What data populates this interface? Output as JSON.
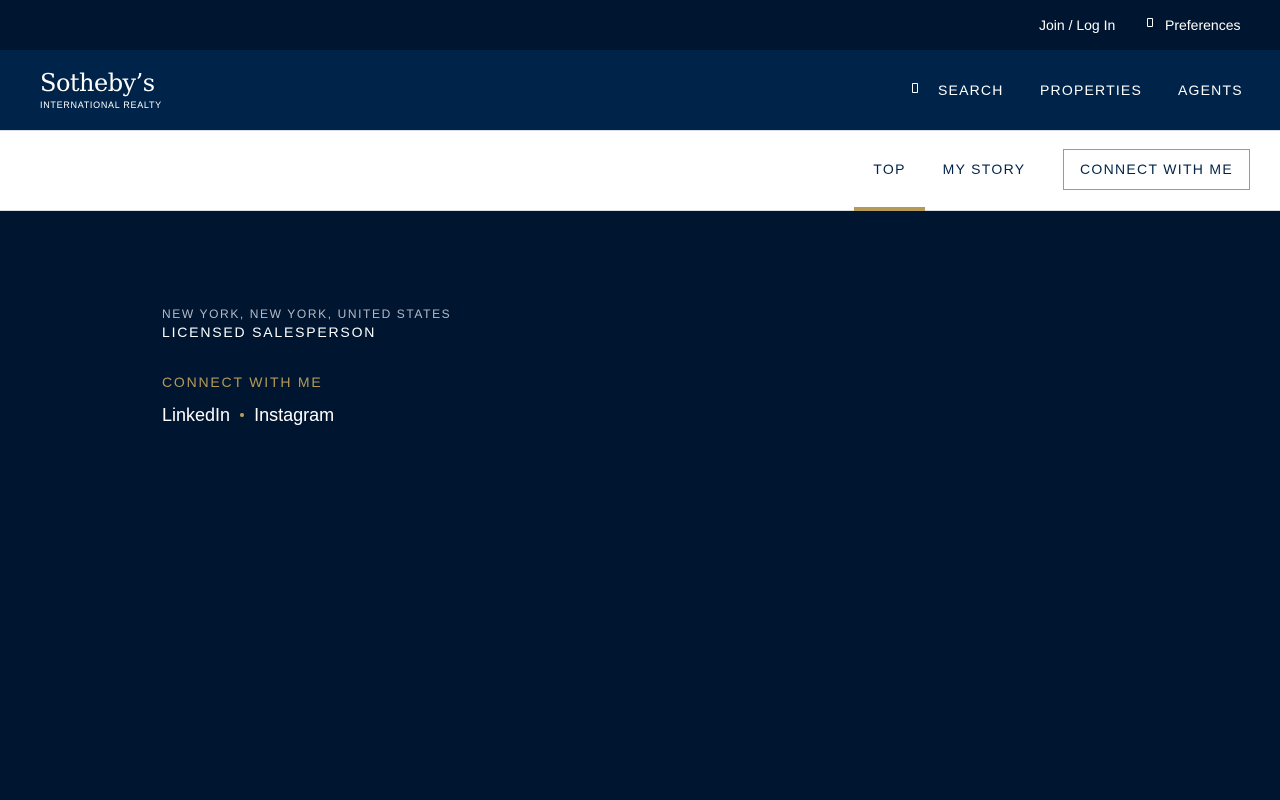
{
  "utility": {
    "join_login": "Join / Log In",
    "preferences": "Preferences"
  },
  "header": {
    "logo_wordmark": "Sotheby’s",
    "logo_subtitle": "INTERNATIONAL REALTY",
    "nav": {
      "search": "SEARCH",
      "properties": "PROPERTIES",
      "agents": "AGENTS"
    }
  },
  "subnav": {
    "tabs": [
      {
        "label": "TOP",
        "active": true
      },
      {
        "label": "MY STORY",
        "active": false
      }
    ],
    "connect_button": "CONNECT WITH ME"
  },
  "hero": {
    "location": "NEW YORK, NEW YORK, UNITED STATES",
    "role": "LICENSED SALESPERSON",
    "connect_heading": "CONNECT WITH ME",
    "social_links": [
      "LinkedIn",
      "Instagram"
    ]
  },
  "colors": {
    "dark_navy": "#001530",
    "header_navy": "#002349",
    "gold_accent": "#b59a57",
    "white": "#ffffff"
  },
  "icons": {
    "preferences": "bookmark-icon",
    "search": "search-icon"
  }
}
